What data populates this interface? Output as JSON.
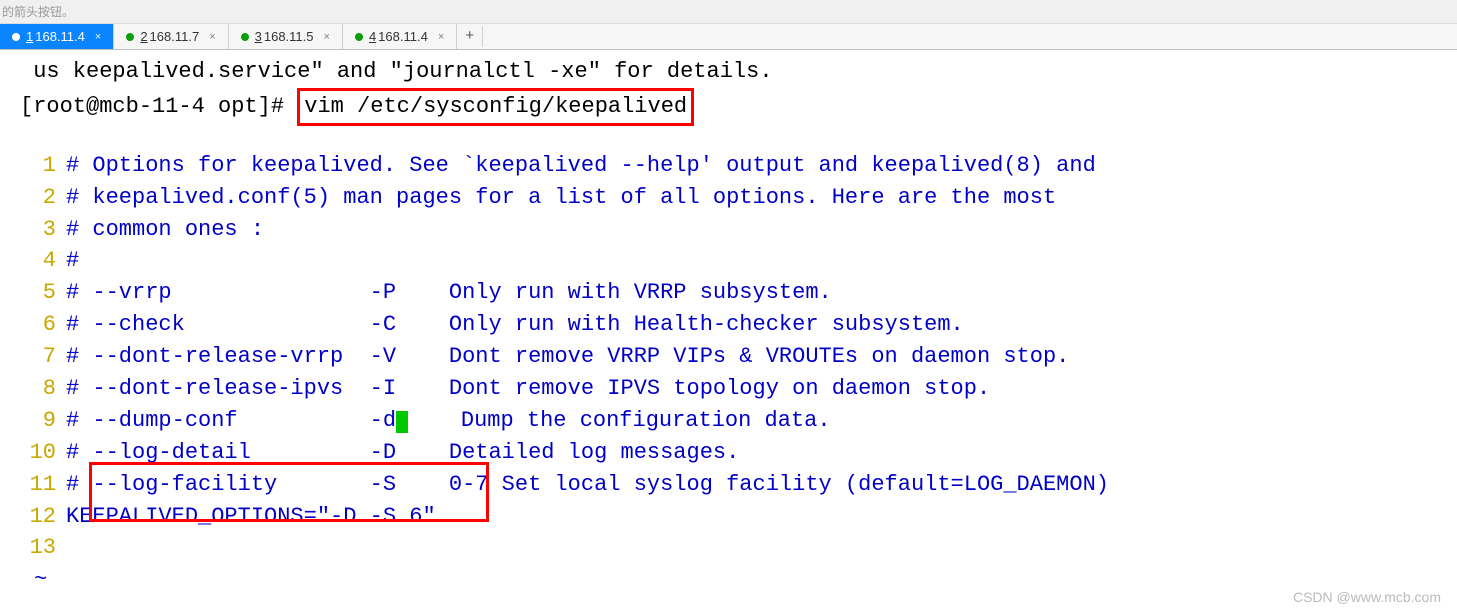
{
  "titlebar": "的箭头按钮。",
  "tabs": [
    {
      "num": "1",
      "ip": "168.11.4",
      "active": true
    },
    {
      "num": "2",
      "ip": "168.11.7",
      "active": false
    },
    {
      "num": "3",
      "ip": "168.11.5",
      "active": false
    },
    {
      "num": "4",
      "ip": "168.11.4",
      "active": false
    }
  ],
  "add_symbol": "+",
  "close_symbol": "×",
  "term": {
    "prev": " us keepalived.service\" and \"journalctl -xe\" for details.",
    "prompt": "[root@mcb-11-4 opt]# ",
    "cmd": "vim /etc/sysconfig/keepalived"
  },
  "vim": {
    "lines": [
      "# Options for keepalived. See `keepalived --help' output and keepalived(8) and",
      "# keepalived.conf(5) man pages for a list of all options. Here are the most",
      "# common ones :",
      "#",
      "# --vrrp               -P    Only run with VRRP subsystem.",
      "# --check              -C    Only run with Health-checker subsystem.",
      "# --dont-release-vrrp  -V    Dont remove VRRP VIPs & VROUTEs on daemon stop.",
      "# --dont-release-ipvs  -I    Dont remove IPVS topology on daemon stop.",
      "# --dump-conf          -d",
      "    Dump the configuration data.",
      "# --log-detail         -D    Detailed log messages.",
      "# --log-facility       -S    0-7 Set local syslog facility (default=LOG_DAEMON)",
      "KEEPALIVED_OPTIONS=\"-D -S 6\"",
      ""
    ]
  },
  "tilde": "~",
  "watermark": "CSDN @www.mcb.com"
}
